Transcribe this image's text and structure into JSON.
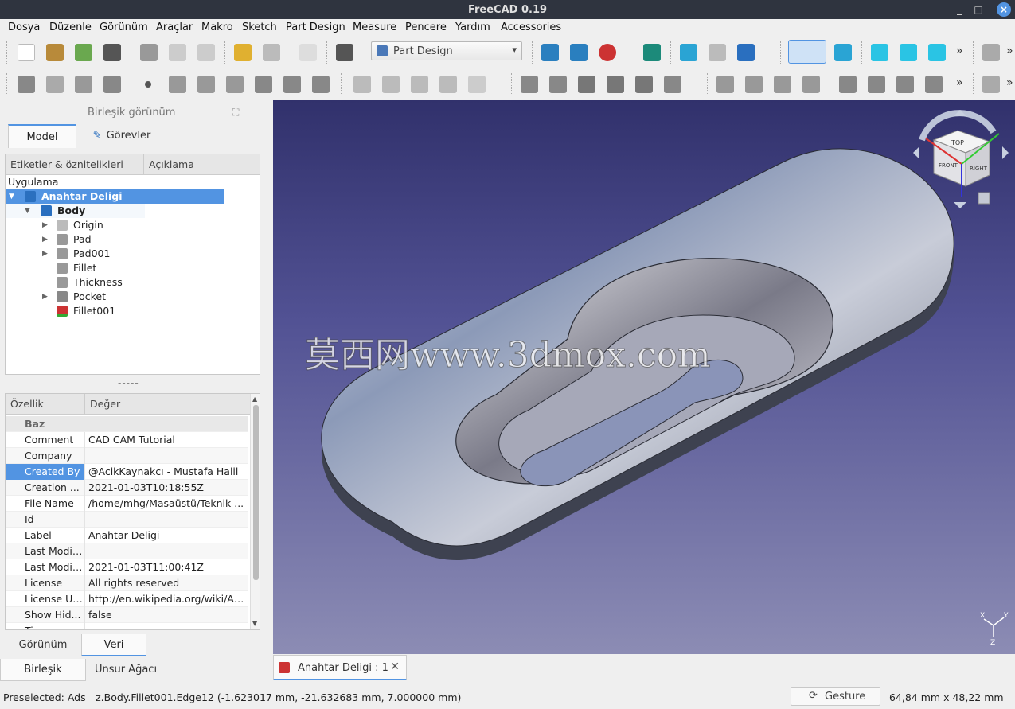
{
  "window": {
    "title": "FreeCAD 0.19"
  },
  "menu": [
    "Dosya",
    "Düzenle",
    "Görünüm",
    "Araçlar",
    "Makro",
    "Sketch",
    "Part Design",
    "Measure",
    "Pencere",
    "Yardım",
    "Accessories"
  ],
  "toolbar": {
    "workbench": "Part Design"
  },
  "combo": {
    "title": "Birleşik görünüm",
    "tab_model": "Model",
    "tab_tasks": "Görevler",
    "bottom_tab_view": "Görünüm",
    "bottom_tab_data": "Veri",
    "panel_tab_combo": "Birleşik görünüm",
    "panel_tab_tree": "Unsur Ağacı"
  },
  "tree": {
    "col_labels": "Etiketler & öznitelikleri",
    "col_desc": "Açıklama",
    "app_label": "Uygulama",
    "items": [
      "Anahtar Deligi",
      "Body",
      "Origin",
      "Pad",
      "Pad001",
      "Fillet",
      "Thickness",
      "Pocket",
      "Fillet001"
    ]
  },
  "splitter": "-----",
  "props": {
    "col_prop": "Özellik",
    "col_value": "Değer",
    "group": "Baz",
    "rows": [
      {
        "k": "Comment",
        "v": "CAD CAM Tutorial"
      },
      {
        "k": "Company",
        "v": ""
      },
      {
        "k": "Created By",
        "v": "@AcikKaynakcı - Mustafa Halil"
      },
      {
        "k": "Creation ...",
        "v": "2021-01-03T10:18:55Z"
      },
      {
        "k": "File Name",
        "v": "/home/mhg/Masaüstü/Teknik ..."
      },
      {
        "k": "Id",
        "v": ""
      },
      {
        "k": "Label",
        "v": "Anahtar Deligi"
      },
      {
        "k": "Last Modif...",
        "v": ""
      },
      {
        "k": "Last Modif...",
        "v": "2021-01-03T11:00:41Z"
      },
      {
        "k": "License",
        "v": "All rights reserved"
      },
      {
        "k": "License URL",
        "v": "http://en.wikipedia.org/wiki/All..."
      },
      {
        "k": "Show Hid...",
        "v": "false"
      },
      {
        "k": "Tip",
        "v": ""
      }
    ]
  },
  "viewport": {
    "watermark": "莫西网www.3dmox.com",
    "navcube": {
      "top": "TOP",
      "front": "FRONT",
      "right": "RIGHT"
    },
    "axes": {
      "x": "X",
      "y": "Y",
      "z": "Z"
    }
  },
  "doc_tab": "Anahtar Deligi : 1",
  "status": {
    "message": "Preselected: Ads__z.Body.Fillet001.Edge12 (-1.623017 mm, -21.632683 mm, 7.000000 mm)",
    "nav_style": "Gesture",
    "dimensions": "64,84 mm x 48,22 mm"
  },
  "colors": {
    "accent": "#5294e2",
    "titlebar": "#2f343f",
    "viewport_top": "#31316c",
    "viewport_bottom": "#8c8cb4"
  }
}
